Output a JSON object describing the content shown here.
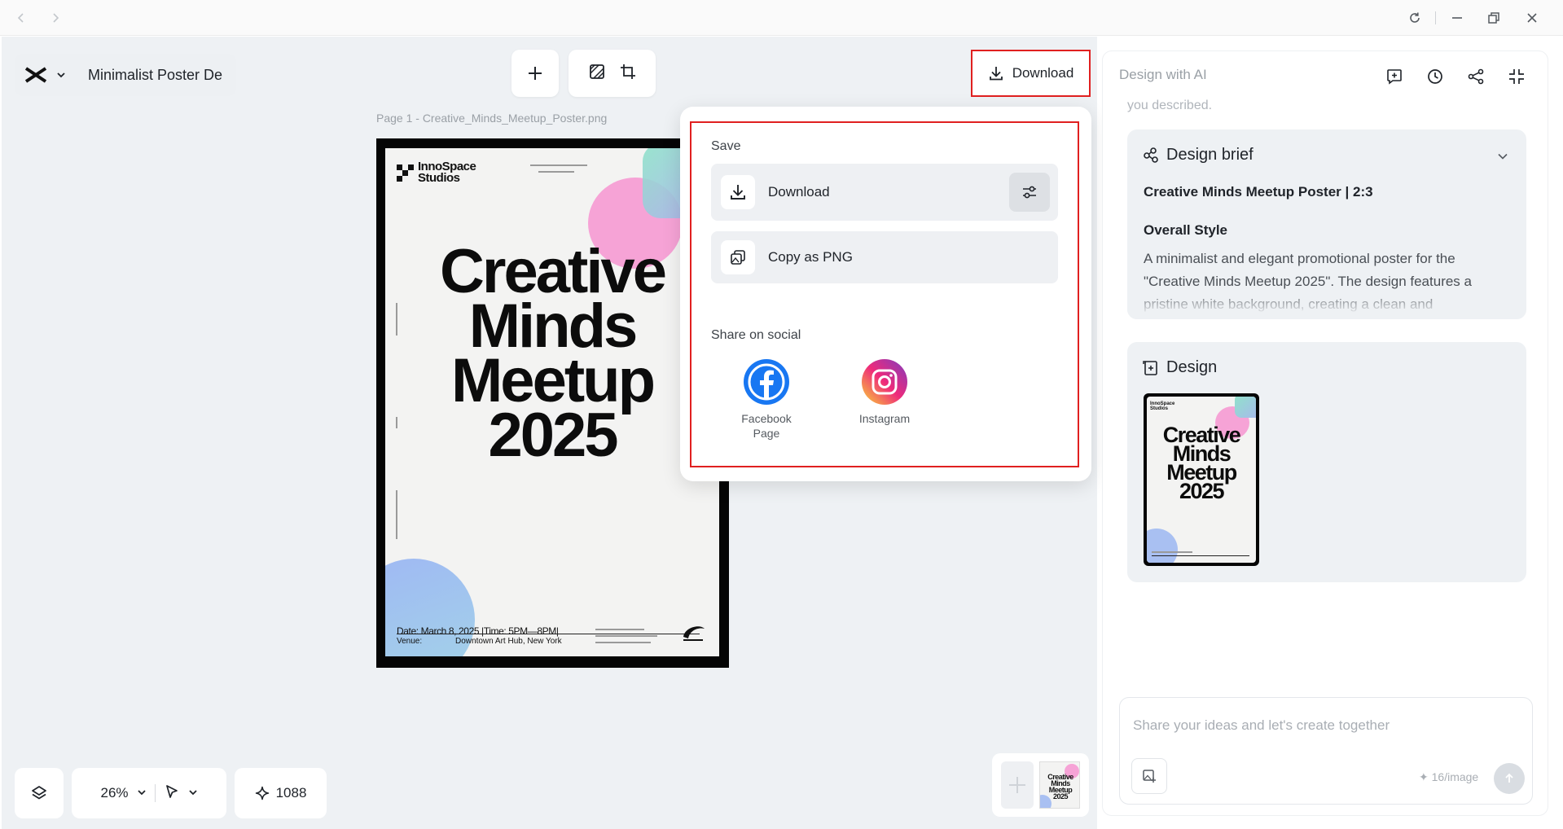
{
  "project": {
    "name": "Minimalist Poster De"
  },
  "header": {
    "download_label": "Download"
  },
  "canvas": {
    "page_label": "Page 1 -  Creative_Minds_Meetup_Poster.png"
  },
  "poster": {
    "brand_line1": "InnoSpace",
    "brand_line2": "Studios",
    "title_line1": "Creative",
    "title_line2": "Minds",
    "title_line3": "Meetup",
    "title_line4": "2025",
    "date_line": "Date: March 8, 2025 |Time: 5PM—8PM|",
    "venue_label": "Venue:",
    "venue_value": "Downtown Art Hub, New York"
  },
  "download_menu": {
    "save_heading": "Save",
    "download_label": "Download",
    "copy_label": "Copy as PNG",
    "share_heading": "Share on social",
    "facebook_line1": "Facebook",
    "facebook_line2": "Page",
    "instagram_label": "Instagram"
  },
  "bottom_toolbar": {
    "zoom": "26%",
    "credits": "1088"
  },
  "ai_panel": {
    "title": "Design with AI",
    "faded_text": "you described.",
    "brief": {
      "heading": "Design brief",
      "subtitle": "Creative Minds Meetup Poster | 2:3",
      "style_heading": "Overall Style",
      "style_text": "A minimalist and elegant promotional poster for the \"Creative Minds Meetup 2025\". The design features a pristine white background, creating a clean and"
    },
    "design": {
      "heading": "Design"
    },
    "input": {
      "placeholder": "Share your ideas and let's create together",
      "cost": "16/image"
    }
  },
  "colors": {
    "accent_red": "#e02020",
    "canvas_bg": "#eef1f4",
    "facebook_blue": "#1877f2"
  }
}
